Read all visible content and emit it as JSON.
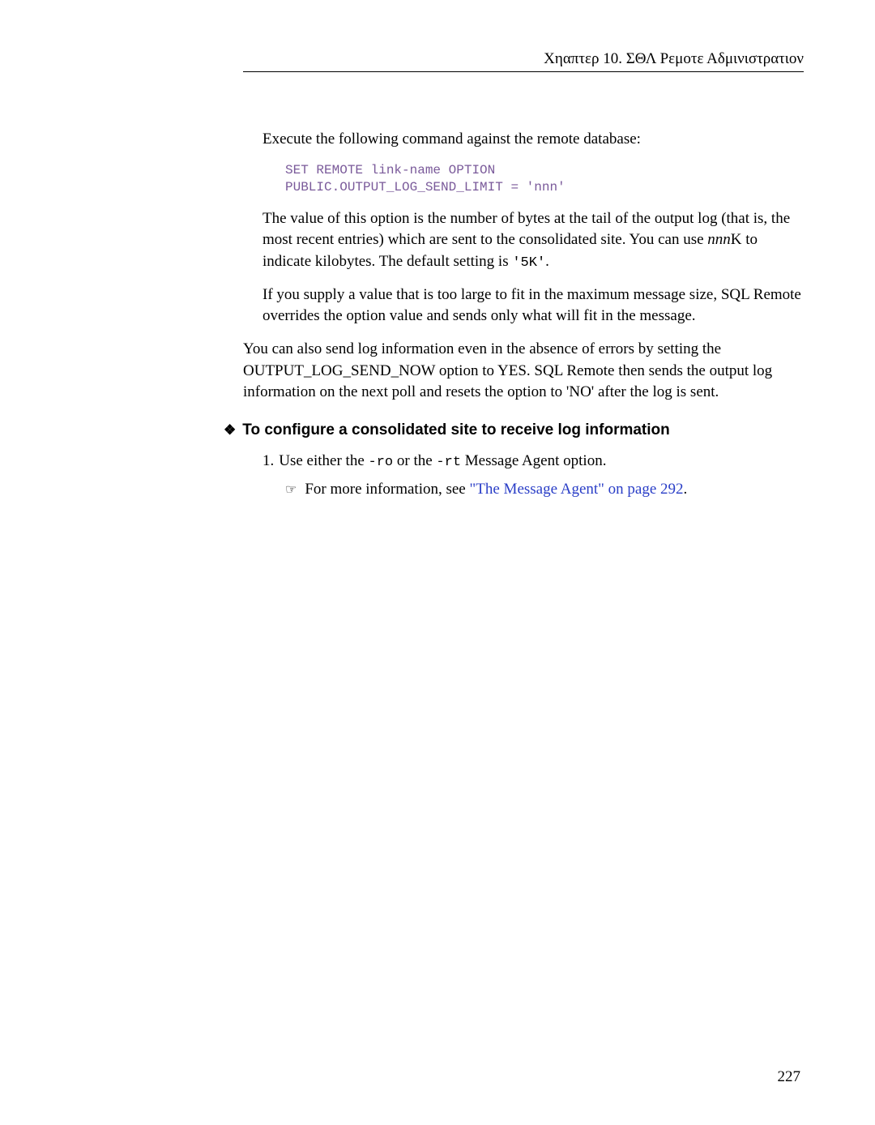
{
  "header": {
    "chapter_label": "Χηαπτερ 10.   ΣΘΛ Ρεμοτε Αδμινιστρατιον"
  },
  "content": {
    "intro": "Execute the following command against the remote database:",
    "code_line1": "SET REMOTE link-name OPTION",
    "code_line2": "PUBLIC.OUTPUT_LOG_SEND_LIMIT = 'nnn'",
    "para1_a": "The value of this option is the number of bytes at the tail of the output log (that is, the most recent entries) which are sent to the consolidated site. You can use ",
    "para1_nnn": "nnn",
    "para1_b": "K to indicate kilobytes. The default setting is ",
    "para1_code": "'5K'",
    "para1_c": ".",
    "para2": "If you supply a value that is too large to fit in the maximum message size, SQL Remote overrides the option value and sends only what will fit in the message.",
    "para3": "You can also send log information even in the absence of errors by setting the OUTPUT_LOG_SEND_NOW option to YES. SQL Remote then sends the output log information on the next poll and resets the option to 'NO' after the log is sent.",
    "heading": "To configure a consolidated site to receive log information",
    "ol1_a": "Use either the ",
    "ol1_code1": "-ro",
    "ol1_b": " or the ",
    "ol1_code2": "-rt",
    "ol1_c": " Message Agent option.",
    "sub_a": "For more information, see ",
    "sub_link": "\"The Message Agent\" on page 292",
    "sub_b": "."
  },
  "page_number": "227"
}
